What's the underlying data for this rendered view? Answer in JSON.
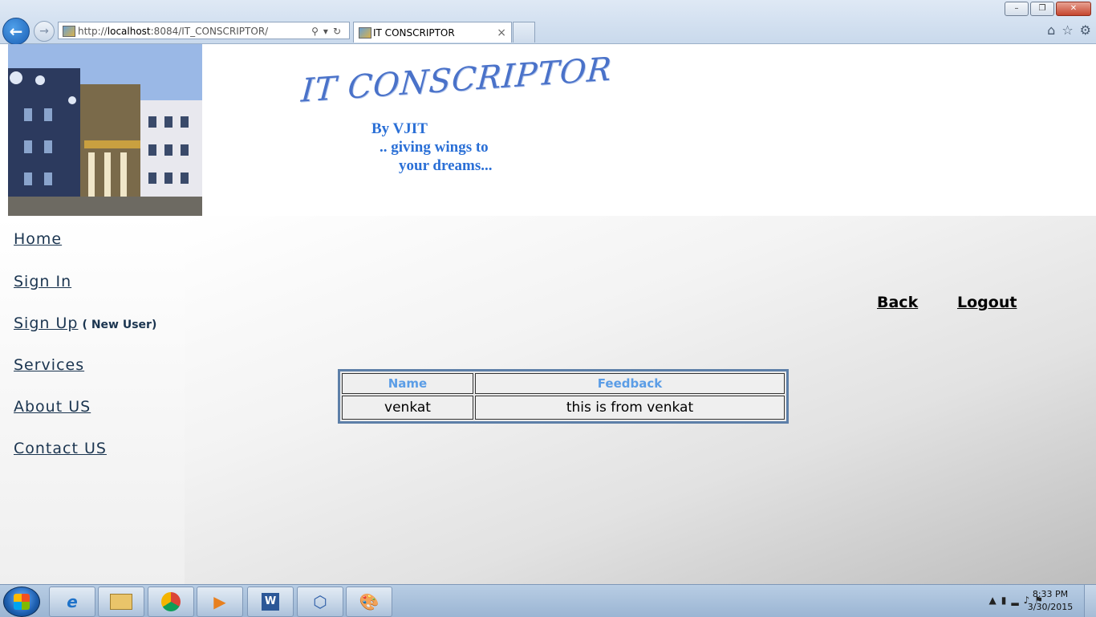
{
  "browser": {
    "url_prefix": "http://",
    "url_host": "localhost",
    "url_rest": ":8084/IT_CONSCRIPTOR/",
    "tab_title": "IT CONSCRIPTOR",
    "window_buttons": [
      "–",
      "❐",
      "✕"
    ]
  },
  "header": {
    "logo_text": "IT CONSCRIPTOR",
    "tagline_1": "By VJIT",
    "tagline_2": ".. giving wings to",
    "tagline_3": "your dreams..."
  },
  "sidebar": {
    "items": [
      {
        "label": "Home"
      },
      {
        "label": "Sign In"
      },
      {
        "label": "Sign Up",
        "note": "( New User)"
      },
      {
        "label": "Services"
      },
      {
        "label": "About US"
      },
      {
        "label": "Contact US"
      }
    ]
  },
  "toplinks": {
    "back": "Back",
    "logout": "Logout"
  },
  "feedback_table": {
    "columns": [
      "Name",
      "Feedback"
    ],
    "rows": [
      [
        "venkat",
        "this is from venkat"
      ]
    ]
  },
  "taskbar": {
    "apps": [
      "internet-explorer-icon",
      "file-explorer-icon",
      "chrome-icon",
      "media-player-icon",
      "word-icon",
      "virtualbox-icon",
      "paint-icon"
    ],
    "time": "8:33 PM",
    "date": "3/30/2015"
  },
  "colors": {
    "accent": "#2a6fd6",
    "table_header": "#5b9de6",
    "nav_text": "#1b3550"
  }
}
